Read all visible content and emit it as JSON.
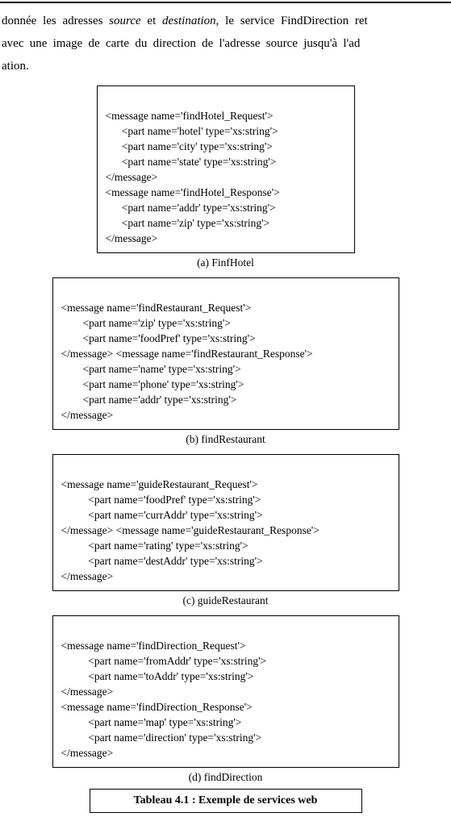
{
  "paragraph": {
    "line1_prefix": "donnée les adresses",
    "line1_source": "source",
    "line1_mid": "et",
    "line1_dest": "destination",
    "line1_suffix": ", le service FindDirection ret",
    "line2": "avec une image de carte du direction de l'adresse source jusqu'à l'ad",
    "line3": "ation."
  },
  "boxA": {
    "l1": "<message name='findHotel_Request'>",
    "l2": "      <part name='hotel' type='xs:string'>",
    "l3": "      <part name='city' type='xs:string'>",
    "l4": "      <part name='state' type='xs:string'>",
    "l5": "</message>",
    "l6": "<message name='findHotel_Response'>",
    "l7": "      <part name='addr' type='xs:string'>",
    "l8": "      <part name='zip' type='xs:string'>",
    "l9": "</message>"
  },
  "captionA": "(a) FinfHotel",
  "boxB": {
    "l1": "<message name='findRestaurant_Request'>",
    "l2": "        <part name='zip' type='xs:string'>",
    "l3": "        <part name='foodPref' type='xs:string'>",
    "l4": "</message> <message name='findRestaurant_Response'>",
    "l5": "        <part name='name' type='xs:string'>",
    "l6": "        <part name='phone' type='xs:string'>",
    "l7": "        <part name='addr' type='xs:string'>",
    "l8": "</message>"
  },
  "captionB": "(b) findRestaurant",
  "boxC": {
    "l1": "<message name='guideRestaurant_Request'>",
    "l2": "          <part name='foodPref' type='xs:string'>",
    "l3": "          <part name='currAddr' type='xs:string'>",
    "l4": "</message> <message name='guideRestaurant_Response'>",
    "l5": "          <part name='rating' type='xs:string'>",
    "l6": "          <part name='destAddr' type='xs:string'>",
    "l7": "</message>"
  },
  "captionC": "(c) guideRestaurant",
  "boxD": {
    "l1": "<message name='findDirection_Request'>",
    "l2": "          <part name='fromAddr' type='xs:string'>",
    "l3": "          <part name='toAddr' type='xs:string'>",
    "l4": "</message>",
    "l5": "<message name='findDirection_Response'>",
    "l6": "          <part name='map' type='xs:string'>",
    "l7": "          <part name='direction' type='xs:string'>",
    "l8": "</message>"
  },
  "captionD": "(d) findDirection",
  "tableCaption": "Tableau 4.1 : Exemple de services web"
}
